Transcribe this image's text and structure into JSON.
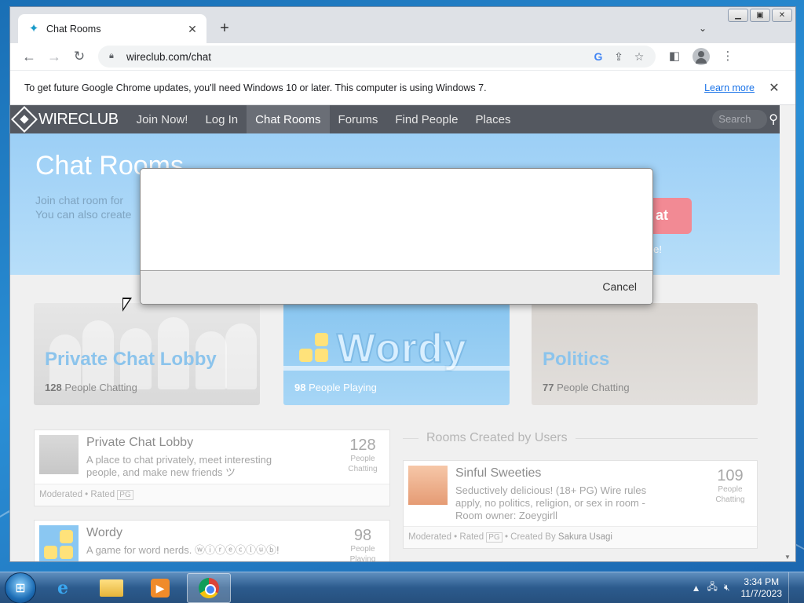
{
  "browser": {
    "tab_title": "Chat Rooms",
    "new_tab_symbol": "+",
    "url": "wireclub.com/chat",
    "infobar_text": "To get future Google Chrome updates, you'll need Windows 10 or later. This computer is using Windows 7.",
    "infobar_link": "Learn more"
  },
  "site": {
    "logo": "WIRECLUB",
    "nav": [
      "Join Now!",
      "Log In",
      "Chat Rooms",
      "Forums",
      "Find People",
      "Places"
    ],
    "search_placeholder": "Search"
  },
  "hero": {
    "title": "Chat Rooms",
    "sub_line1": "Join chat room",
    "sub_line1_tail": "for",
    "sub_line2": "You can also create",
    "button_fragment": "at",
    "hint_fragment": "e!"
  },
  "tiles": [
    {
      "title": "Private Chat Lobby",
      "count": "128",
      "count_label": "People Chatting"
    },
    {
      "title": "Wordy",
      "count": "98",
      "count_label": "People Playing"
    },
    {
      "title": "Politics",
      "count": "77",
      "count_label": "People Chatting"
    }
  ],
  "rooms": [
    {
      "name": "Private Chat Lobby",
      "desc": "A place to chat privately, meet interesting people, and make new friends ツ",
      "count": "128",
      "count_label_1": "People",
      "count_label_2": "Chatting",
      "meta_moderated": "Moderated",
      "meta_rated_label": "Rated",
      "meta_rating": "PG"
    },
    {
      "name": "Wordy",
      "desc": "A game for word nerds. ⓦⓘⓡⓔⓒⓛⓤⓑ!",
      "count": "98",
      "count_label_1": "People",
      "count_label_2": "Playing"
    }
  ],
  "user_rooms": {
    "section_title": "Rooms Created by Users",
    "items": [
      {
        "name": "Sinful Sweeties",
        "desc": "Seductively delicious! (18+ PG) Wire rules apply, no politics, religion, or sex in room - Room owner: Zoeygirll",
        "count": "109",
        "count_label_1": "People",
        "count_label_2": "Chatting",
        "meta_moderated": "Moderated",
        "meta_rated_label": "Rated",
        "meta_rating": "PG",
        "meta_created_by": "Created By",
        "creator": "Sakura Usagi"
      }
    ]
  },
  "dialog": {
    "cancel_label": "Cancel"
  },
  "taskbar": {
    "time": "3:34 PM",
    "date": "11/7/2023"
  },
  "colors": {
    "site_nav_bg": "#545860",
    "hero_bg": "#9ccff6",
    "tile_title": "#8cc4ec",
    "link_blue": "#1a73e8"
  }
}
